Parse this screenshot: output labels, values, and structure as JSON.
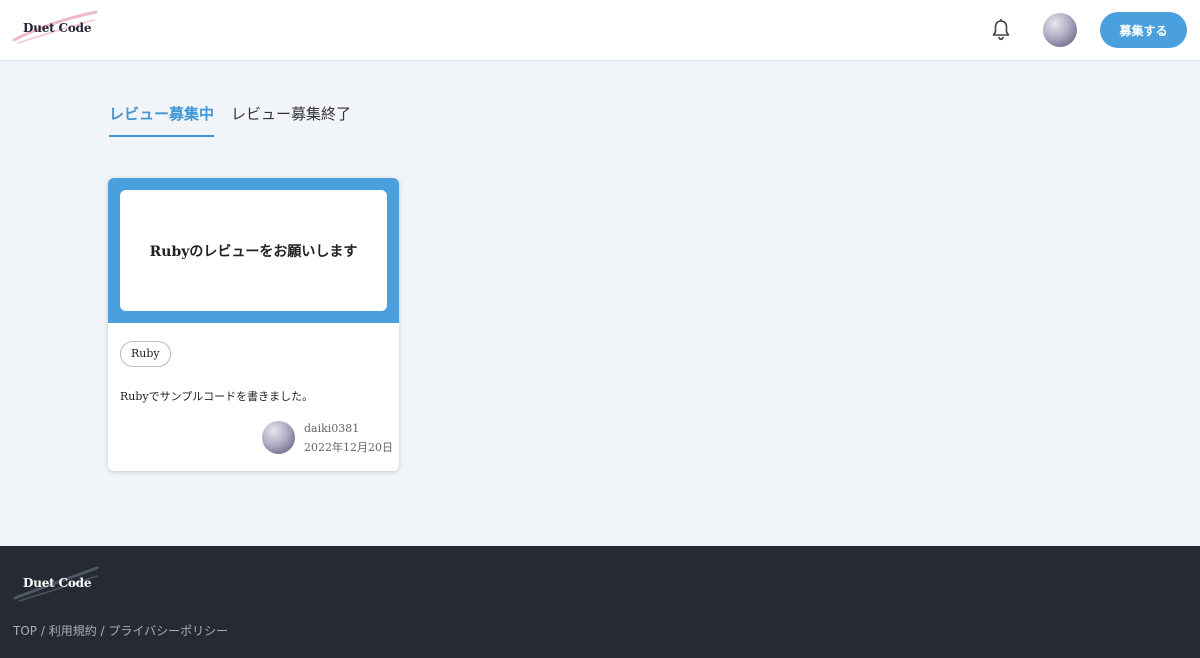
{
  "header": {
    "logo_text": "Duet Code",
    "recruit_button": "募集する",
    "icons": {
      "notification": "bell-icon",
      "user": "avatar"
    }
  },
  "tabs": [
    {
      "label": "レビュー募集中",
      "active": true
    },
    {
      "label": "レビュー募集終了",
      "active": false
    }
  ],
  "cards": [
    {
      "title": "Rubyのレビューをお願いします",
      "tag": "Ruby",
      "description": "Rubyでサンプルコードを書きました。",
      "user": "daiki0381",
      "date": "2022年12月20日"
    }
  ],
  "footer": {
    "logo_text": "Duet Code",
    "links": [
      "TOP",
      "利用規約",
      "プライバシーポリシー"
    ],
    "separator": " / "
  },
  "colors": {
    "accent": "#4a9fdd",
    "background": "#f1f4f8",
    "footer": "#252a33"
  }
}
